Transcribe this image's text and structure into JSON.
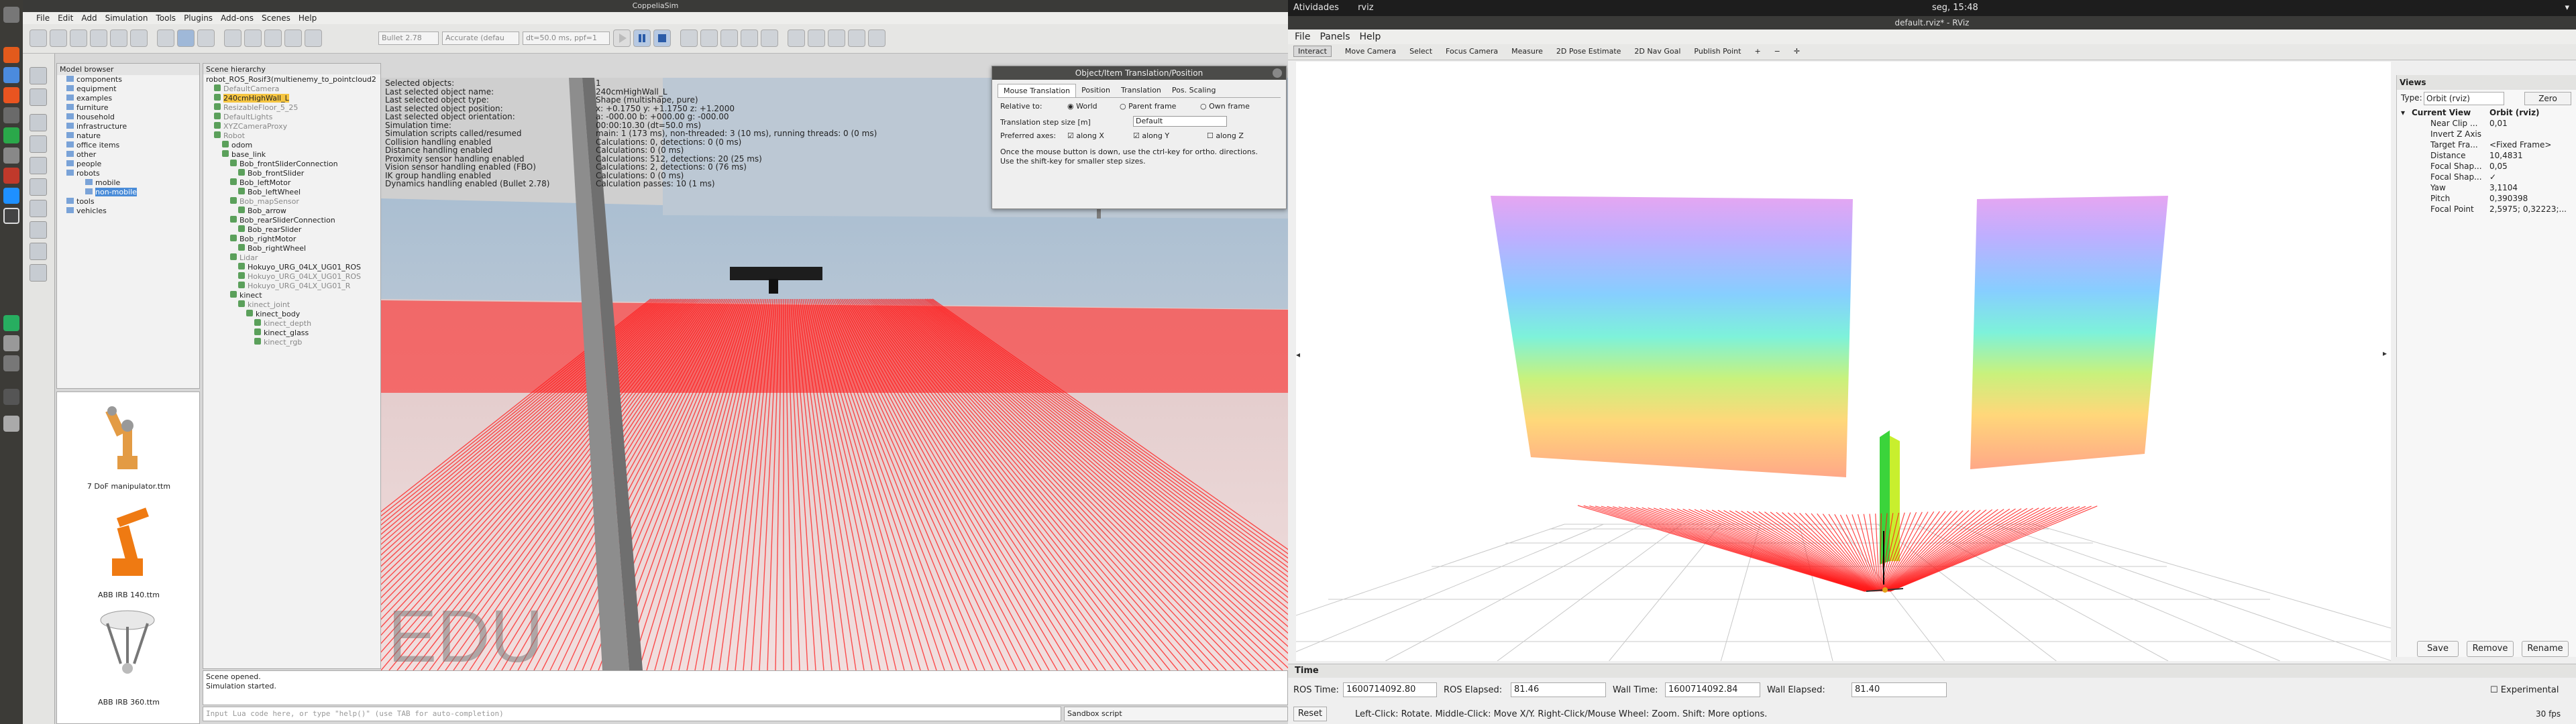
{
  "coppelia": {
    "title": "CoppeliaSim",
    "menu": [
      "File",
      "Edit",
      "Add",
      "Simulation",
      "Tools",
      "Plugins",
      "Add-ons",
      "Scenes",
      "Help"
    ],
    "toolbar_combos": [
      "Bullet 2.78",
      "Accurate (defau",
      "dt=50.0 ms, ppf=1"
    ],
    "model_browser": {
      "title": "Model browser",
      "items": [
        "components",
        "equipment",
        "examples",
        "furniture",
        "household",
        "infrastructure",
        "nature",
        "office items",
        "other",
        "people",
        "robots",
        "mobile",
        "non-mobile",
        "tools",
        "vehicles"
      ],
      "selected": "non-mobile",
      "thumbnails": [
        "7 DoF manipulator.ttm",
        "ABB IRB 140.ttm",
        "ABB IRB 360.ttm"
      ]
    },
    "scene_hierarchy": {
      "tab_title": "robot_ROS_Rosif3(multienemy_to_pointcloud2",
      "title": "Scene hierarchy",
      "items": [
        "DefaultCamera",
        "240cmHighWall_L",
        "ResizableFloor_5_25",
        "DefaultLights",
        "XYZCameraProxy",
        "Robot",
        "odom",
        "base_link",
        "Bob_frontSliderConnection",
        "Bob_frontSlider",
        "Bob_leftMotor",
        "Bob_leftWheel",
        "Bob_mapSensor",
        "Bob_arrow",
        "Bob_rearSliderConnection",
        "Bob_rearSlider",
        "Bob_rightMotor",
        "Bob_rightWheel",
        "Lidar",
        "Hokuyo_URG_04LX_UG01_ROS",
        "Hokuyo_URG_04LX_UG01_ROS",
        "Hokuyo_URG_04LX_UG01_R",
        "kinect",
        "kinect_joint",
        "kinect_body",
        "kinect_depth",
        "kinect_glass",
        "kinect_rgb"
      ]
    },
    "info_left": [
      "Selected objects:",
      "Last selected object name:",
      "Last selected object type:",
      "Last selected object position:",
      "Last selected object orientation:",
      "Simulation time:",
      "Simulation scripts called/resumed",
      "Collision handling enabled",
      "Distance handling enabled",
      "Proximity sensor handling enabled",
      "Vision sensor handling enabled (FBO)",
      "IK group handling enabled",
      "Dynamics handling enabled (Bullet 2.78)"
    ],
    "info_right": [
      "1",
      "240cmHighWall_L",
      "Shape (multishape, pure)",
      "x: +0.1750    y: +1.1750    z: +1.2000",
      "a: -000.00    b: +000.00    g: -000.00",
      "00:00:10.30 (dt=50.0 ms)",
      "main: 1 (173 ms), non-threaded: 3 (10 ms), running threads: 0 (0 ms)",
      "Calculations: 0, detections: 0 (0 ms)",
      "Calculations: 0 (0 ms)",
      "Calculations: 512, detections: 20 (25 ms)",
      "Calculations: 2, detections: 0 (76 ms)",
      "Calculations: 0 (0 ms)",
      "Calculation passes: 10 (1 ms)"
    ],
    "watermark": "EDU",
    "dialog": {
      "title": "Object/Item Translation/Position",
      "tabs": [
        "Mouse Translation",
        "Position",
        "Translation",
        "Pos. Scaling"
      ],
      "relative_label": "Relative to:",
      "relative_opts": [
        "World",
        "Parent frame",
        "Own frame"
      ],
      "step_label": "Translation step size [m]",
      "step_value": "Default",
      "axes_label": "Preferred axes:",
      "axes": [
        "along X",
        "along Y",
        "along Z"
      ],
      "note": "Once the mouse button is down, use the ctrl-key for ortho. directions. Use the shift-key for smaller step sizes."
    },
    "status": [
      "Scene opened.",
      "Simulation started."
    ],
    "lua_placeholder": "Input Lua code here, or type \"help()\" (use TAB for auto-completion)",
    "sandbox": "Sandbox script"
  },
  "desktop": {
    "activities": "Atividades",
    "app": "rviz",
    "clock": "seg, 15:48"
  },
  "rviz": {
    "title": "default.rviz* - RViz",
    "menu": [
      "File",
      "Panels",
      "Help"
    ],
    "tools": [
      "Interact",
      "Move Camera",
      "Select",
      "Focus Camera",
      "Measure",
      "2D Pose Estimate",
      "2D Nav Goal",
      "Publish Point"
    ],
    "views": {
      "title": "Views",
      "type_label": "Type:",
      "type_value": "Orbit (rviz)",
      "zero": "Zero",
      "current": "Current View",
      "current_value": "Orbit (rviz)",
      "props": [
        {
          "k": "Near Clip ...",
          "v": "0,01"
        },
        {
          "k": "Invert Z Axis",
          "v": ""
        },
        {
          "k": "Target Fra...",
          "v": "<Fixed Frame>"
        },
        {
          "k": "Distance",
          "v": "10,4831"
        },
        {
          "k": "Focal Shap...",
          "v": "0,05"
        },
        {
          "k": "Focal Shap...",
          "v": "✓"
        },
        {
          "k": "Yaw",
          "v": "3,1104"
        },
        {
          "k": "Pitch",
          "v": "0,390398"
        },
        {
          "k": "Focal Point",
          "v": "2,5975; 0,32223;..."
        }
      ],
      "buttons": [
        "Save",
        "Remove",
        "Rename"
      ]
    },
    "time": {
      "title": "Time",
      "ros_time_label": "ROS Time:",
      "ros_time": "1600714092.80",
      "ros_elapsed_label": "ROS Elapsed:",
      "ros_elapsed": "81.46",
      "wall_time_label": "Wall Time:",
      "wall_time": "1600714092.84",
      "wall_elapsed_label": "Wall Elapsed:",
      "wall_elapsed": "81.40",
      "experimental": "Experimental",
      "reset": "Reset",
      "help": "Left-Click: Rotate. Middle-Click: Move X/Y. Right-Click/Mouse Wheel: Zoom. Shift: More options.",
      "fps": "30 fps"
    }
  },
  "colors": {
    "laser": "#ff1a1a",
    "selection": "#4a8cd8",
    "scene_sel": "#f5c542"
  }
}
